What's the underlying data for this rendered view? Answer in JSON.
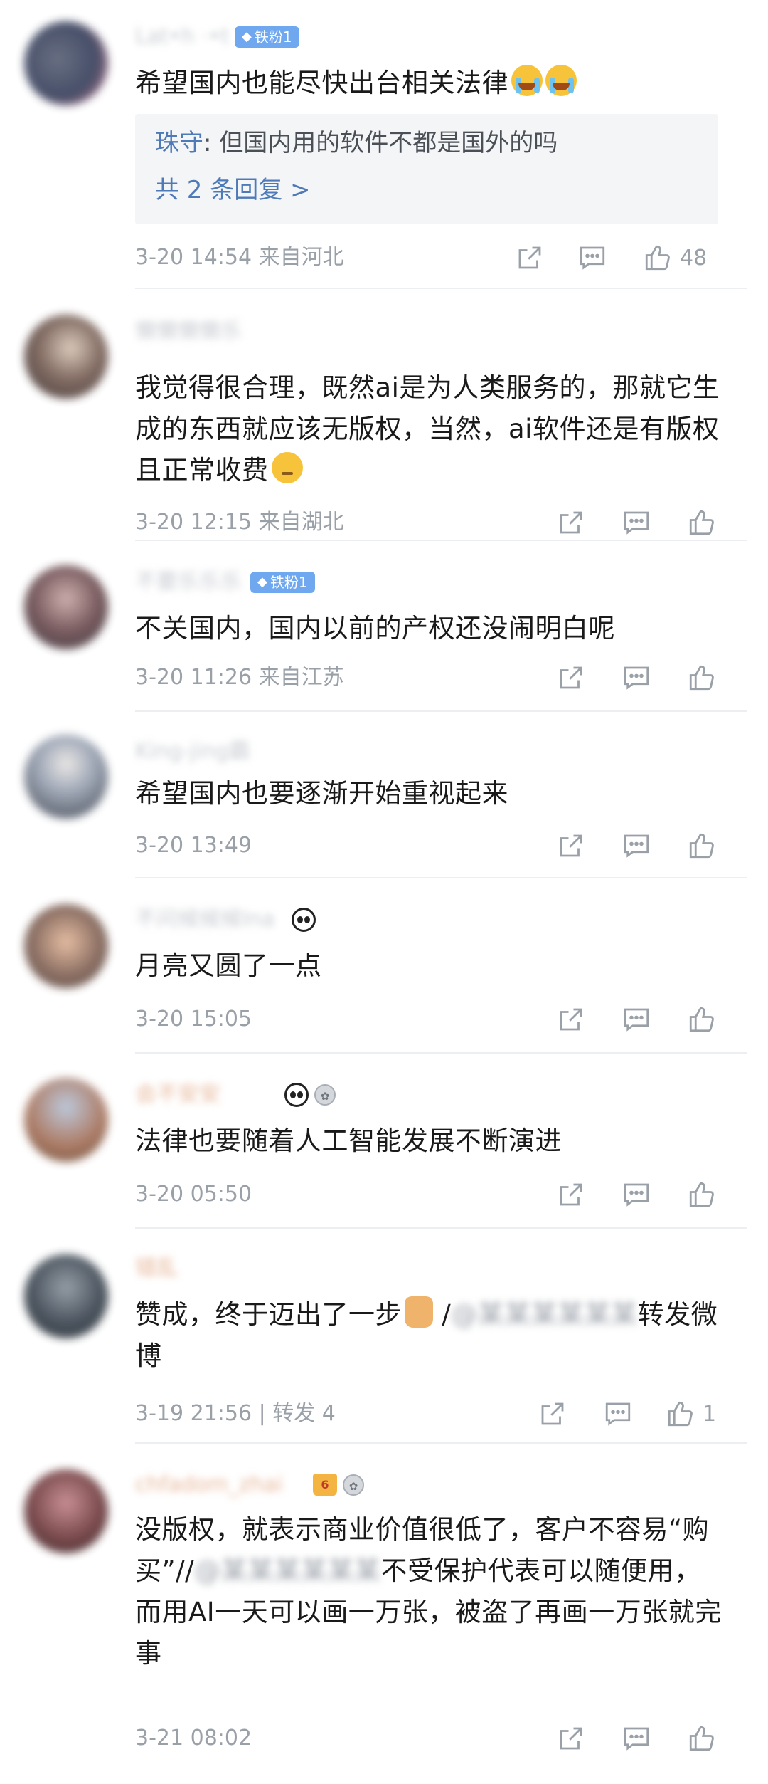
{
  "comments": [
    {
      "username": "Lat•h  ·•t",
      "fan_badge": "铁粉1",
      "text": "希望国内也能尽快出台相关法律",
      "emojis": [
        "crying-emoji",
        "crying-emoji"
      ],
      "reply": {
        "name": "珠守",
        "text": ": 但国内用的软件不都是国外的吗",
        "more": "共 2 条回复 >"
      },
      "time": "3-20 14:54",
      "location": "来自河北",
      "likes": "48",
      "avatar_color": "#37405c"
    },
    {
      "username": "懒懒懒懒乐",
      "text": "我觉得很合理，既然ai是为人类服务的，那就它生成的东西就应该无版权，当然，ai软件还是有版权且正常收费",
      "emojis": [
        "thinking-emoji"
      ],
      "time": "3-20 12:15",
      "location": "来自湖北",
      "avatar_color": "#6b5a55"
    },
    {
      "username": "不要乐乐乐",
      "fan_badge": "铁粉1",
      "text": "不关国内，国内以前的产权还没闹明白呢",
      "time": "3-20 11:26",
      "location": "来自江苏",
      "avatar_color": "#6e4e52"
    },
    {
      "username": "King-jing霸",
      "text": "希望国内也要逐渐开始重视起来",
      "time": "3-20 13:49",
      "avatar_color": "#6a7486"
    },
    {
      "username": "不问候候候Ina",
      "text": "月亮又圆了一点",
      "time": "3-20 15:05",
      "avatar_color": "#8a6a5c"
    },
    {
      "username": "会不安安",
      "text": "法律也要随着人工智能发展不断演进",
      "time": "3-20 05:50",
      "avatar_color": "#a7735c"
    },
    {
      "username": "错乱",
      "text_before": "赞成，终于迈出了一步",
      "mention": "@某某某某某某",
      "text_after": "转发微博",
      "time": "3-19 21:56",
      "repost_label": "| 转发 4",
      "likes": "1",
      "avatar_color": "#3b4550"
    },
    {
      "username": "chfadom_zhai",
      "text_before": "没版权，就表示商业价值很低了，客户不容易“购买”//",
      "mention": "@某某某某某某",
      "text_after": "不受保护代表可以随便用，而用AI一天可以画一万张，被盗了再画一万张就完事",
      "time": "3-21 08:02",
      "avatar_color": "#6d3a3d"
    }
  ]
}
